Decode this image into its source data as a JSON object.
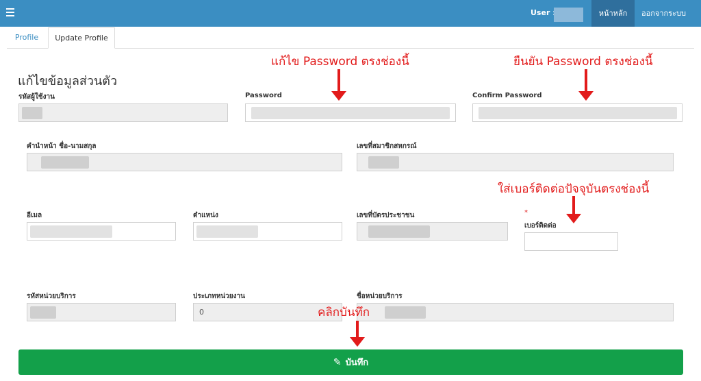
{
  "topbar": {
    "menu_icon": "hamburger-icon",
    "user_label": "User :",
    "home": "หน้าหลัก",
    "logout": "ออกจากระบบ",
    "color": "#3b8ec2"
  },
  "tabs": [
    "Profile",
    "Update Profile"
  ],
  "section_title": "แก้ไขข้อมูลส่วนตัว",
  "fields": {
    "username": {
      "label": "รหัสผู้ใช้งาน"
    },
    "password": {
      "label": "Password"
    },
    "confirm_password": {
      "label": "Confirm Password"
    },
    "fullname": {
      "label": "คำนำหน้า ชื่อ-นามสกุล"
    },
    "member_no": {
      "label": "เลขที่สมาชิกสหกรณ์"
    },
    "email": {
      "label": "อีเมล"
    },
    "position": {
      "label": "ตำแหน่ง"
    },
    "id_card": {
      "label": "เลขที่บัตรประชาชน"
    },
    "phone": {
      "label": "เบอร์ติดต่อ",
      "required": "*"
    },
    "unit_code": {
      "label": "รหัสหน่วยบริการ"
    },
    "unit_type": {
      "label": "ประเภทหน่วยงาน",
      "value": "0"
    },
    "unit_name": {
      "label": "ชื่อหน่วยบริการ"
    }
  },
  "annotations": {
    "password": "แก้ไข Password ตรงช่องนี้",
    "confirm": "ยืนยัน Password ตรงช่องนี้",
    "phone": "ใส่เบอร์ติดต่อปัจจุบันตรงช่องนี้",
    "save": "คลิกบันทึก"
  },
  "save_button": {
    "label": "บันทึก",
    "icon": "pencil-icon",
    "color": "#13a04a"
  },
  "annotation_color": "#e21b1b"
}
